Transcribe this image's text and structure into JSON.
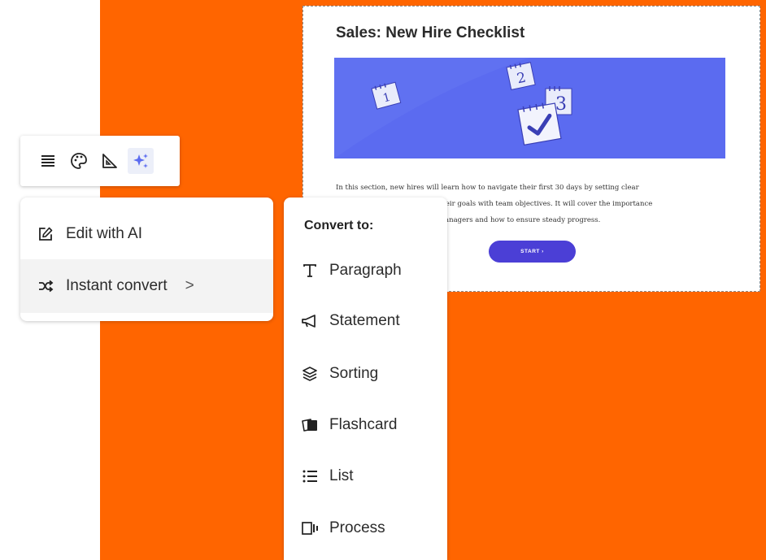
{
  "colors": {
    "background_orange": "#FF6500",
    "banner_blue": "#5B6BF0",
    "button_purple": "#4B3FD6",
    "accent_blue": "#5B6BF0"
  },
  "card": {
    "title": "Sales: New Hire Checklist",
    "banner_numbers": [
      "1",
      "2",
      "3"
    ],
    "body_lines": [
      "In this section, new hires will learn how to navigate their first 30 days by setting clear",
      "their goals with team objectives. It will cover the importance",
      "managers and how to ensure steady progress."
    ],
    "start_label": "START ›"
  },
  "toolbar": {
    "tools": [
      {
        "icon": "align-icon"
      },
      {
        "icon": "palette-icon"
      },
      {
        "icon": "ruler-triangle-icon"
      },
      {
        "icon": "sparkle-icon",
        "active": true
      }
    ]
  },
  "ai_menu": {
    "items": [
      {
        "label": "Edit with AI",
        "icon": "edit-pencil-icon"
      },
      {
        "label": "Instant convert",
        "icon": "shuffle-icon",
        "chevron": ">"
      }
    ]
  },
  "convert_menu": {
    "heading": "Convert to:",
    "items": [
      {
        "label": "Paragraph",
        "icon": "text-t-icon"
      },
      {
        "label": "Statement",
        "icon": "megaphone-icon"
      },
      {
        "label": "Sorting",
        "icon": "layers-icon"
      },
      {
        "label": "Flashcard",
        "icon": "flashcard-icon"
      },
      {
        "label": "List",
        "icon": "list-icon"
      },
      {
        "label": "Process",
        "icon": "process-icon"
      }
    ]
  }
}
